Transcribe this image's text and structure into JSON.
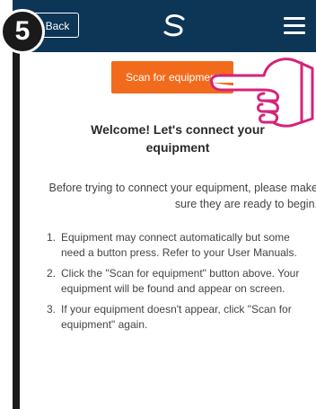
{
  "header": {
    "back_label": "Back",
    "step_number": "5",
    "logo_icon": "swirl-logo-icon",
    "menu_icon": "hamburger-menu-icon",
    "bar_color": "#0c3556"
  },
  "main": {
    "scan_button_label": "Scan for equipment",
    "scan_button_color": "#f26b1d",
    "welcome_line1": "Welcome! Let's connect your",
    "welcome_line2": "equipment",
    "intro_text": "Before trying to connect your equipment, please make sure they are ready to begin.",
    "steps": [
      {
        "num": "1.",
        "text": "Equipment may connect automatically but some need a button press. Refer to your User Manuals."
      },
      {
        "num": "2.",
        "text": "Click the \"Scan for equipment\" button above. Your equipment will be found and appear on screen."
      },
      {
        "num": "3.",
        "text": "If your equipment doesn't appear, click \"Scan for equipment\" again."
      }
    ]
  },
  "overlay": {
    "pointer_icon": "pointing-hand-icon",
    "pointer_color": "#d6237a"
  }
}
